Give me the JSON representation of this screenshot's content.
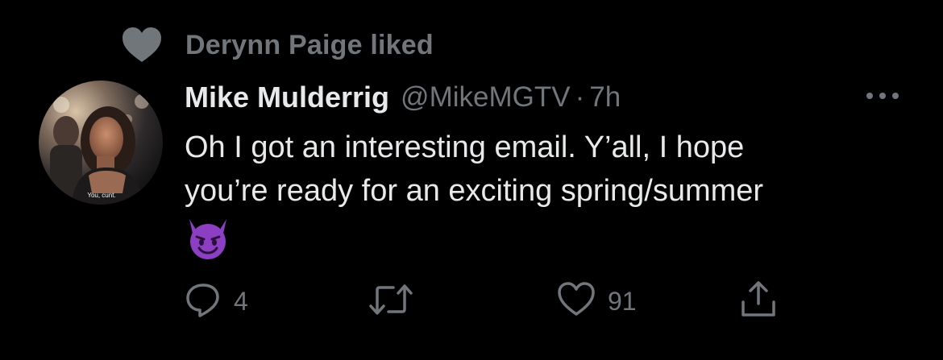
{
  "social_context": {
    "icon": "heart-icon",
    "text": "Derynn Paige liked"
  },
  "author": {
    "display_name": "Mike Mulderrig",
    "handle": "@MikeMGTV",
    "separator": "·",
    "time": "7h",
    "avatar_caption": "You, cunt."
  },
  "tweet": {
    "text_lines": [
      "Oh I got an interesting email. Y’all, I hope",
      "you’re ready for an exciting spring/summer"
    ],
    "emoji": "smiling-face-with-horns"
  },
  "actions": {
    "reply": {
      "icon": "reply-icon",
      "count": "4"
    },
    "retweet": {
      "icon": "retweet-icon",
      "count": ""
    },
    "like": {
      "icon": "heart-outline-icon",
      "count": "91"
    },
    "share": {
      "icon": "share-icon",
      "count": ""
    },
    "more": {
      "icon": "more-icon"
    }
  },
  "colors": {
    "background": "#000000",
    "primary_text": "#e7e9ea",
    "secondary_text": "#71767b",
    "emoji_purple": "#8d3fc3"
  }
}
